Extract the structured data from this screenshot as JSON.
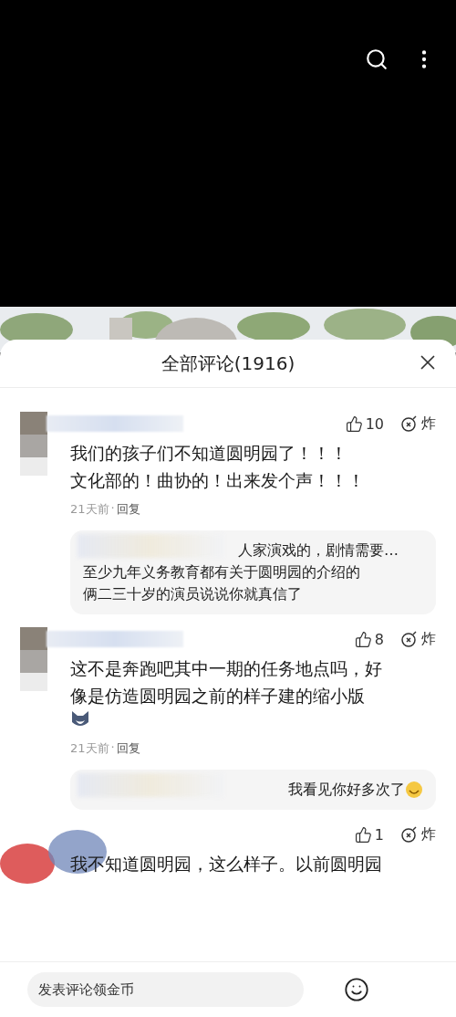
{
  "sheet": {
    "title": "全部评论(1916)"
  },
  "comments": [
    {
      "avatar": {
        "kind": "mosaic"
      },
      "likes": "10",
      "bomb": "炸",
      "lines": [
        "我们的孩子们不知道圆明园了！！！",
        "文化部的！曲协的！出来发个声！！！"
      ],
      "time": "21天前",
      "separator": "·",
      "reply": "回复",
      "replies": [
        {
          "lines": [
            "人家演戏的，剧情需要…",
            "至少九年义务教育都有关于圆明园的介绍的",
            "俩二三十岁的演员说说你就真信了"
          ]
        }
      ]
    },
    {
      "avatar": {
        "kind": "mosaic"
      },
      "likes": "8",
      "bomb": "炸",
      "lines": [
        "这不是奔跑吧其中一期的任务地点吗，好",
        "像是仿造圆明园之前的样子建的缩小版"
      ],
      "emoji": {
        "kind": "dog"
      },
      "time": "21天前",
      "separator": "·",
      "reply": "回复",
      "replies": [
        {
          "lines": [
            "我看见你好多次了"
          ],
          "emoji": {
            "kind": "smile"
          }
        }
      ]
    },
    {
      "avatar": {
        "kind": "scribble"
      },
      "likes": "1",
      "bomb": "炸",
      "lines": [
        "我不知道圆明园，这么样子。以前圆明园"
      ]
    }
  ],
  "composer": {
    "placeholder": "发表评论领金币"
  }
}
